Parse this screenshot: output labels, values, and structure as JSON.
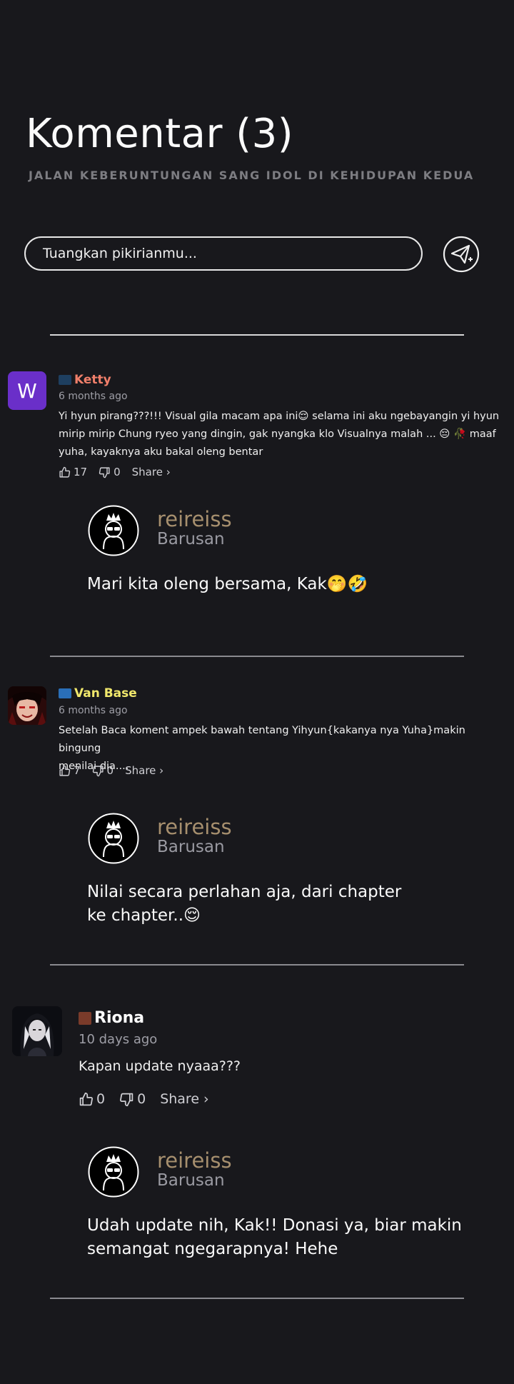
{
  "page": {
    "title": "Komentar (3)",
    "subtitle": "JALAN KEBERUNTUNGAN SANG IDOL DI KEHIDUPAN KEDUA"
  },
  "composer": {
    "placeholder": "Tuangkan pikirianmu..."
  },
  "comments": [
    {
      "avatar_letter": "W",
      "username": "Ketty",
      "username_color": "#f07f6a",
      "time": "6 months ago",
      "text_line1": "Yi hyun pirang???!!! Visual gila macam apa ini😌  selama ini aku ngebayangin yi hyun",
      "text_line2": "mirip mirip Chung ryeo yang dingin, gak nyangka klo Visualnya malah ... 😔 🥀  maaf",
      "text_line3": "yuha, kayaknya aku bakal oleng bentar",
      "likes": "17",
      "dislikes": "0",
      "share_label": "Share ›",
      "reply": {
        "username": "reireiss",
        "time": "Barusan",
        "text_line1": "Mari kita oleng bersama, Kak🤭🤣"
      }
    },
    {
      "username": "Van Base",
      "username_color": "#f1e86c",
      "time": "6 months ago",
      "text_line1": "Setelah Baca koment ampek bawah tentang Yihyun{kakanya nya Yuha}makin bingung",
      "text_line2": "menilai dia....",
      "likes": "7",
      "dislikes": "0",
      "share_label": "Share ›",
      "reply": {
        "username": "reireiss",
        "time": "Barusan",
        "text_line1": "Nilai secara perlahan aja, dari chapter",
        "text_line2": "ke chapter..😌"
      }
    },
    {
      "username": "Riona",
      "username_color": "#ffffff",
      "time": "10 days ago",
      "text_line1": "Kapan update nyaaa???",
      "likes": "0",
      "dislikes": "0",
      "share_label": "Share ›",
      "reply": {
        "username": "reireiss",
        "time": "Barusan",
        "text_line1": "Udah update nih, Kak!! Donasi ya, biar makin",
        "text_line2": "semangat ngegarapnya! Hehe"
      }
    }
  ]
}
